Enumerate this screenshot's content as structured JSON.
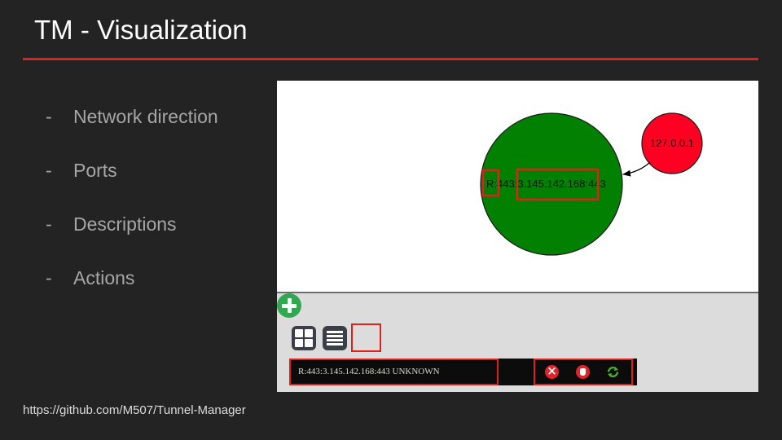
{
  "slide": {
    "title": "TM - Visualization",
    "bullet_marker": "-",
    "bullets": [
      "Network direction",
      "Ports",
      "Descriptions",
      "Actions"
    ],
    "footer_url": "https://github.com/M507/Tunnel-Manager"
  },
  "screenshot": {
    "graph": {
      "remote_node": {
        "label_prefix": "R:",
        "label_port": "443",
        "label_separator": ":",
        "label_target": "3.145.142.168",
        "label_suffix": ":443",
        "fill": "#028002"
      },
      "local_node": {
        "label": "127.0.0.1",
        "fill": "#ff0022"
      }
    },
    "toolbar": {
      "grid_view_icon": "grid-icon",
      "list_view_icon": "list-icon",
      "add_icon": "plus-circle-icon"
    },
    "tunnel": {
      "description": "R:443:3.145.142.168:443 UNKNOWN",
      "actions": [
        "remove-icon",
        "stop-hand-icon",
        "refresh-icon"
      ]
    },
    "colors": {
      "highlight": "#e0201b",
      "accent_rule": "#e0201b"
    }
  }
}
